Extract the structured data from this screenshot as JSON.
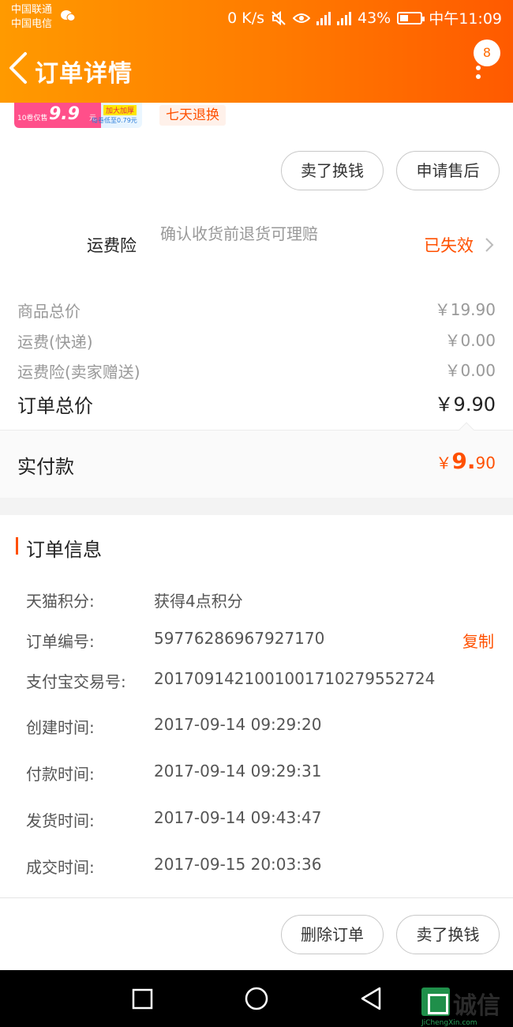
{
  "status_bar": {
    "carrier1": "中国联通",
    "carrier2": "中国电信",
    "net_speed": "0 K/s",
    "battery": "43%",
    "battery_level": 0.43,
    "time": "中午11:09"
  },
  "nav": {
    "title": "订单详情",
    "message_badge": "8"
  },
  "product": {
    "promo_small": "10卷仅售",
    "promo_price": "9.9",
    "promo_unit": "元",
    "promo_tag": "加大加厚",
    "promo_sub": "每卷低至0.79元",
    "return_tag": "七天退换"
  },
  "item_actions": {
    "sell_label": "卖了换钱",
    "after_sale_label": "申请售后"
  },
  "insurance": {
    "label": "运费险",
    "description": "确认收货前退货可理赔",
    "status": "已失效"
  },
  "prices": {
    "goods_total_label": "商品总价",
    "goods_total_value": "￥19.90",
    "shipping_label": "运费(快递)",
    "shipping_value": "￥0.00",
    "insurance_label": "运费险(卖家赠送)",
    "insurance_value": "￥0.00",
    "order_total_label": "订单总价",
    "order_total_value": "￥9.90",
    "paid_label": "实付款",
    "paid_currency": "￥",
    "paid_int": "9.",
    "paid_dec": "90"
  },
  "order_info": {
    "title": "订单信息",
    "rows": [
      {
        "key": "天猫积分:",
        "value": "获得4点积分"
      },
      {
        "key": "订单编号:",
        "value": "59776286967927170"
      },
      {
        "key": "支付宝交易号:",
        "value": "2017091421001001710279552724"
      },
      {
        "key": "创建时间:",
        "value": "2017-09-14 09:29:20"
      },
      {
        "key": "付款时间:",
        "value": "2017-09-14 09:29:31"
      },
      {
        "key": "发货时间:",
        "value": "2017-09-14 09:43:47"
      },
      {
        "key": "成交时间:",
        "value": "2017-09-15 20:03:36"
      }
    ],
    "copy_label": "复制"
  },
  "bottom_actions": {
    "delete_label": "删除订单",
    "sell_label": "卖了换钱"
  },
  "watermark": {
    "text": "诚信",
    "sub": "JiChengXin.com"
  }
}
